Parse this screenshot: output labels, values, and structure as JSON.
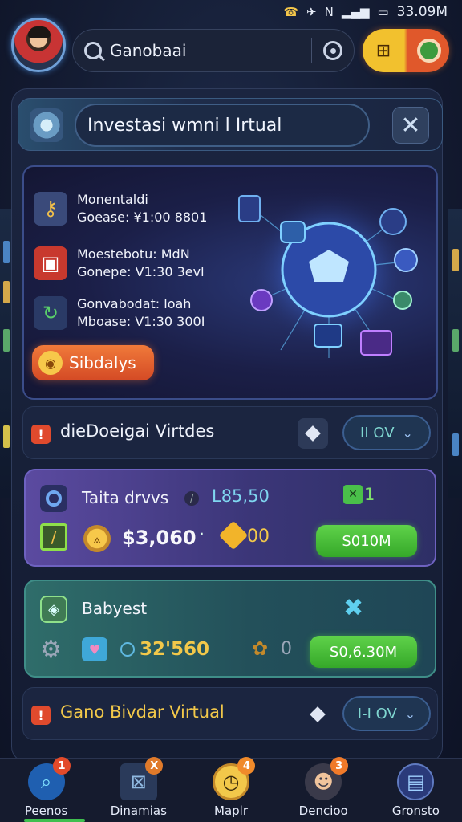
{
  "status_bar": {
    "time": "33.09M"
  },
  "header": {
    "search_text": "Ganobaai"
  },
  "title_bar": {
    "title": "Investasi wmni l Irtual"
  },
  "hero": {
    "items": [
      {
        "title": "Monentaldi",
        "subtitle": "Goease: ¥1:00 8801",
        "icon": "key-icon"
      },
      {
        "title": "Moestebotu: MdN",
        "subtitle": "Gonepe: V1:30 3evl",
        "icon": "bag-icon"
      },
      {
        "title": "Gonvabodat: loah",
        "subtitle": "Mboase: V1:30 300I",
        "icon": "refresh-icon"
      }
    ],
    "button_label": "Sibdalys"
  },
  "section1": {
    "title": "dieDoeigai Virtdes",
    "pill_value": "II OV"
  },
  "card1": {
    "title": "Taita drvvs",
    "price": "L85,50",
    "tag": "1",
    "amount": "$3,060",
    "bullet": "·",
    "count": "00",
    "button_label": "S010M"
  },
  "card2": {
    "title": "Babyest",
    "amount": "32'560",
    "count": "0",
    "button_label": "S0,6.30M"
  },
  "section2": {
    "title": "Gano Bivdar Virtual",
    "pill_value": "I-I OV"
  },
  "nav": {
    "tabs": [
      {
        "label": "Peenos",
        "badge": "1",
        "icon": "search-globe-icon"
      },
      {
        "label": "Dinamias",
        "badge": "X",
        "icon": "map-icon"
      },
      {
        "label": "Maplr",
        "badge": "4",
        "icon": "compass-icon"
      },
      {
        "label": "Dencioo",
        "badge": "3",
        "icon": "person-icon"
      },
      {
        "label": "Gronsto",
        "badge": "",
        "icon": "wallet-icon"
      }
    ]
  },
  "colors": {
    "accent_orange": "#e0582b",
    "accent_green": "#35a829",
    "card_purple": "#5b4aa0",
    "card_teal": "#2f6d6a"
  }
}
